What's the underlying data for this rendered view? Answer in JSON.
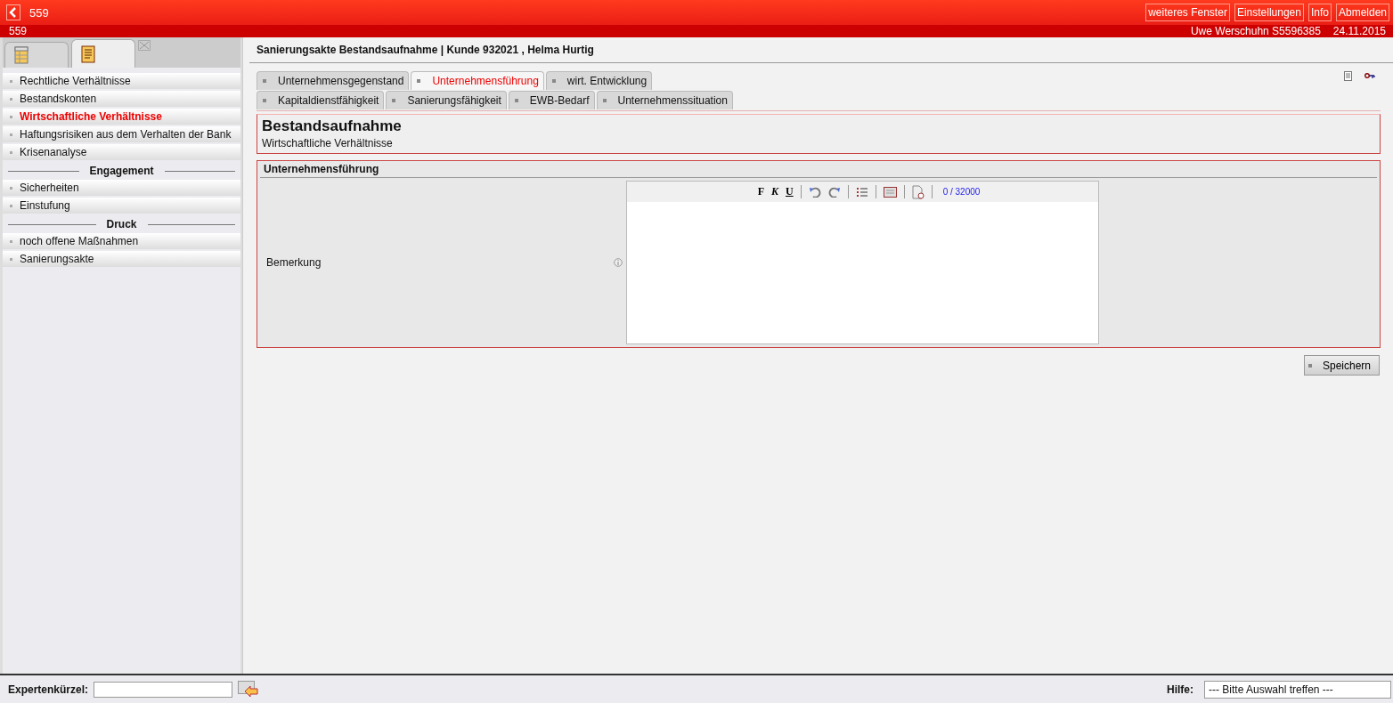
{
  "header": {
    "title": "559",
    "subtitle": "559",
    "buttons": [
      "weiteres Fenster",
      "Einstellungen",
      "Info",
      "Abmelden"
    ],
    "user": "Uwe Werschuhn S5596385",
    "date": "24.11.2015"
  },
  "sidebar": {
    "tabs": [
      {
        "kind": "table",
        "selected": false
      },
      {
        "kind": "document",
        "selected": true
      }
    ],
    "items": [
      {
        "kind": "item",
        "label": "Rechtliche Verhältnisse",
        "selected": false
      },
      {
        "kind": "item",
        "label": "Bestandskonten",
        "selected": false
      },
      {
        "kind": "item",
        "label": "Wirtschaftliche Verhältnisse",
        "selected": true
      },
      {
        "kind": "item",
        "label": "Haftungsrisiken aus dem Verhalten der Bank",
        "selected": false
      },
      {
        "kind": "item",
        "label": "Krisenanalyse",
        "selected": false
      },
      {
        "kind": "header",
        "label": "Engagement"
      },
      {
        "kind": "item",
        "label": "Sicherheiten",
        "selected": false
      },
      {
        "kind": "item",
        "label": "Einstufung",
        "selected": false
      },
      {
        "kind": "header",
        "label": "Druck"
      },
      {
        "kind": "item",
        "label": "noch offene Maßnahmen",
        "selected": false
      },
      {
        "kind": "item",
        "label": "Sanierungsakte",
        "selected": false
      }
    ]
  },
  "page": {
    "title": "Sanierungsakte Bestandsaufnahme | Kunde 932021 , Helma Hurtig",
    "tab_rows": [
      [
        {
          "label": "Unternehmensgegenstand",
          "selected": false
        },
        {
          "label": "Unternehmensführung",
          "selected": true
        },
        {
          "label": "wirt. Entwicklung",
          "selected": false
        }
      ],
      [
        {
          "label": "Kapitaldienstfähigkeit",
          "selected": false
        },
        {
          "label": "Sanierungsfähigkeit",
          "selected": false
        },
        {
          "label": "EWB-Bedarf",
          "selected": false
        },
        {
          "label": "Unternehmenssituation",
          "selected": false
        }
      ]
    ],
    "heading": "Bestandsaufnahme",
    "subheading": "Wirtschaftliche Verhältnisse",
    "section": {
      "title": "Unternehmensführung",
      "field_label": "Bemerkung",
      "format_buttons": [
        "F",
        "K",
        "U"
      ],
      "counter": "0 / 32000"
    },
    "save_button": "Speichern"
  },
  "footer": {
    "expert_label": "Expertenkürzel:",
    "help_label": "Hilfe:",
    "help_value": "--- Bitte Auswahl treffen ---"
  }
}
